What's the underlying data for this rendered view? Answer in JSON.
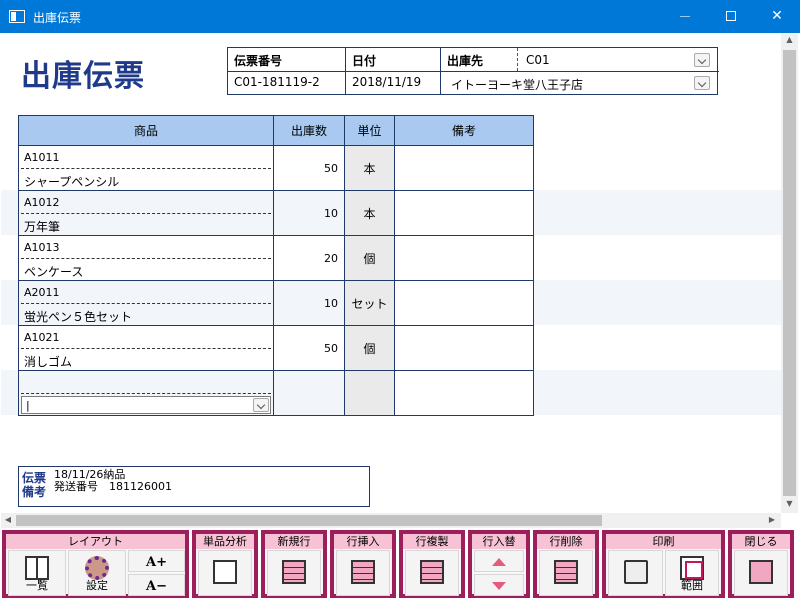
{
  "window": {
    "title": "出庫伝票"
  },
  "page": {
    "title": "出庫伝票"
  },
  "header": {
    "slip_no_label": "伝票番号",
    "slip_no": "C01-181119-2",
    "date_label": "日付",
    "date": "2018/11/19",
    "dest_label": "出庫先",
    "dest_code": "C01",
    "dest_name": "イトーヨーキ堂八王子店"
  },
  "grid": {
    "columns": [
      "商品",
      "出庫数",
      "単位",
      "備考"
    ],
    "rows": [
      {
        "code": "A1011",
        "name": "シャープペンシル",
        "qty": "50",
        "unit": "本",
        "note": ""
      },
      {
        "code": "A1012",
        "name": "万年筆",
        "qty": "10",
        "unit": "本",
        "note": ""
      },
      {
        "code": "A1013",
        "name": "ペンケース",
        "qty": "20",
        "unit": "個",
        "note": ""
      },
      {
        "code": "A2011",
        "name": "蛍光ペン５色セット",
        "qty": "10",
        "unit": "セット",
        "note": ""
      },
      {
        "code": "A1021",
        "name": "消しゴム",
        "qty": "50",
        "unit": "個",
        "note": ""
      }
    ],
    "entry_caret": "|"
  },
  "memo": {
    "label": "伝票備考",
    "line1": "18/11/26納品",
    "line2": "発送番号　181126001"
  },
  "toolbar": {
    "layout_group": "レイアウト",
    "list_label": "一覧",
    "settings_label": "設定",
    "font_up": "A+",
    "font_down": "A−",
    "analysis_group": "単品分析",
    "new_row_group": "新規行",
    "insert_row_group": "行挿入",
    "copy_row_group": "行複製",
    "swap_row_group": "行入替",
    "delete_row_group": "行削除",
    "print_group": "印刷",
    "range_label": "範囲",
    "close_group": "閉じる"
  }
}
